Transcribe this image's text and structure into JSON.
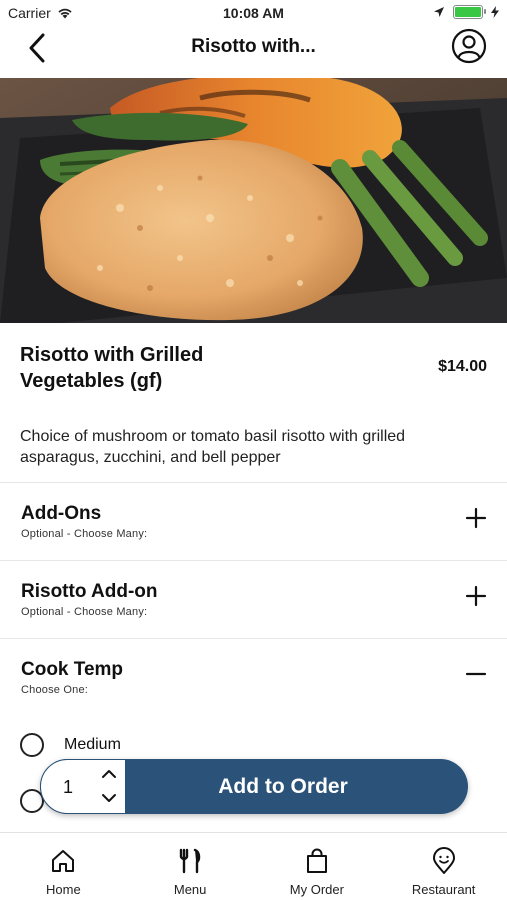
{
  "status": {
    "carrier": "Carrier",
    "time": "10:08 AM",
    "battery_level": 1.0
  },
  "nav": {
    "title": "Risotto with...",
    "back_icon": "chevron-left-icon",
    "profile_icon": "user-circle-icon"
  },
  "item": {
    "name": "Risotto with Grilled Vegetables (gf)",
    "price": "$14.00",
    "description": "Choice of mushroom or tomato basil risotto with grilled asparagus, zucchini, and bell pepper"
  },
  "sections": [
    {
      "title": "Add-Ons",
      "subtitle": "Optional - Choose Many:",
      "state": "collapsed"
    },
    {
      "title": "Risotto Add-on",
      "subtitle": "Optional - Choose Many:",
      "state": "collapsed"
    },
    {
      "title": "Cook Temp",
      "subtitle": "Choose One:",
      "state": "expanded"
    }
  ],
  "cook_temp_options": [
    {
      "label": "Medium",
      "selected": false
    },
    {
      "label": "",
      "selected": false
    }
  ],
  "order": {
    "quantity": "1",
    "button_label": "Add to Order"
  },
  "tabs": [
    {
      "label": "Home",
      "icon": "home-icon"
    },
    {
      "label": "Menu",
      "icon": "utensils-icon"
    },
    {
      "label": "My Order",
      "icon": "shopping-bag-icon"
    },
    {
      "label": "Restaurant",
      "icon": "location-pin-icon"
    }
  ],
  "colors": {
    "accent": "#2b5278",
    "battery": "#3ac844"
  }
}
